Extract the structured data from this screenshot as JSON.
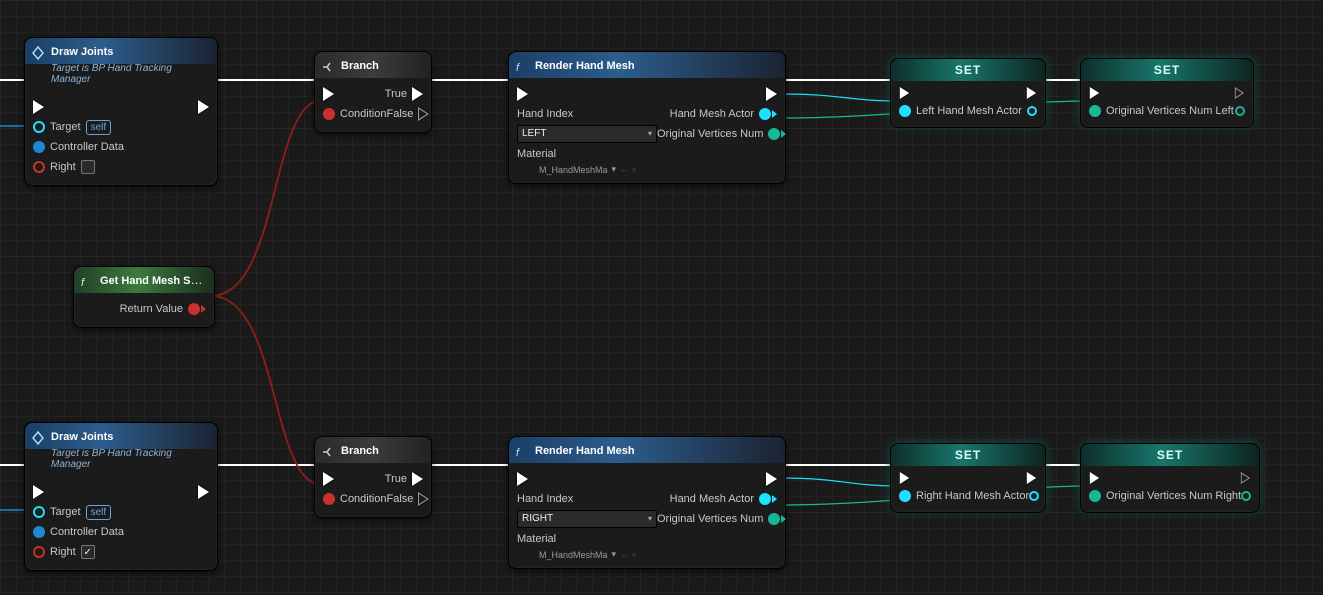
{
  "nodes": {
    "drawJoints": {
      "title": "Draw Joints",
      "subtitle": "Target is BP Hand Tracking Manager",
      "target": "Target",
      "self": "self",
      "controller": "Controller Data",
      "right": "Right"
    },
    "branch": {
      "title": "Branch",
      "condition": "Condition",
      "true": "True",
      "false": "False"
    },
    "render": {
      "title": "Render Hand Mesh",
      "handIndex": "Hand Index",
      "material": "Material",
      "matAsset": "M_HandMeshMa",
      "outActor": "Hand Mesh Actor",
      "outVerts": "Original Vertices Num"
    },
    "leftOpt": "LEFT",
    "rightOpt": "RIGHT",
    "getStatus": {
      "title": "Get Hand Mesh Status",
      "ret": "Return Value"
    },
    "set": {
      "title": "SET",
      "leftActor": "Left Hand Mesh Actor",
      "vertsLeft": "Original Vertices Num Left",
      "rightActor": "Right Hand Mesh Actor",
      "vertsRight": "Original Vertices Num Right"
    }
  }
}
